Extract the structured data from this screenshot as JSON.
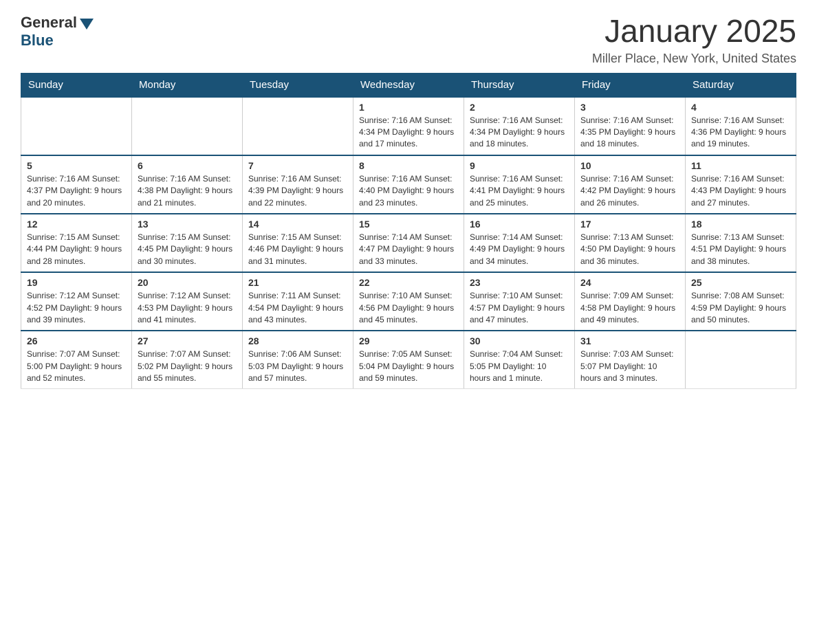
{
  "header": {
    "logo_general": "General",
    "logo_blue": "Blue",
    "month_title": "January 2025",
    "location": "Miller Place, New York, United States"
  },
  "weekdays": [
    "Sunday",
    "Monday",
    "Tuesday",
    "Wednesday",
    "Thursday",
    "Friday",
    "Saturday"
  ],
  "weeks": [
    [
      {
        "day": "",
        "info": ""
      },
      {
        "day": "",
        "info": ""
      },
      {
        "day": "",
        "info": ""
      },
      {
        "day": "1",
        "info": "Sunrise: 7:16 AM\nSunset: 4:34 PM\nDaylight: 9 hours\nand 17 minutes."
      },
      {
        "day": "2",
        "info": "Sunrise: 7:16 AM\nSunset: 4:34 PM\nDaylight: 9 hours\nand 18 minutes."
      },
      {
        "day": "3",
        "info": "Sunrise: 7:16 AM\nSunset: 4:35 PM\nDaylight: 9 hours\nand 18 minutes."
      },
      {
        "day": "4",
        "info": "Sunrise: 7:16 AM\nSunset: 4:36 PM\nDaylight: 9 hours\nand 19 minutes."
      }
    ],
    [
      {
        "day": "5",
        "info": "Sunrise: 7:16 AM\nSunset: 4:37 PM\nDaylight: 9 hours\nand 20 minutes."
      },
      {
        "day": "6",
        "info": "Sunrise: 7:16 AM\nSunset: 4:38 PM\nDaylight: 9 hours\nand 21 minutes."
      },
      {
        "day": "7",
        "info": "Sunrise: 7:16 AM\nSunset: 4:39 PM\nDaylight: 9 hours\nand 22 minutes."
      },
      {
        "day": "8",
        "info": "Sunrise: 7:16 AM\nSunset: 4:40 PM\nDaylight: 9 hours\nand 23 minutes."
      },
      {
        "day": "9",
        "info": "Sunrise: 7:16 AM\nSunset: 4:41 PM\nDaylight: 9 hours\nand 25 minutes."
      },
      {
        "day": "10",
        "info": "Sunrise: 7:16 AM\nSunset: 4:42 PM\nDaylight: 9 hours\nand 26 minutes."
      },
      {
        "day": "11",
        "info": "Sunrise: 7:16 AM\nSunset: 4:43 PM\nDaylight: 9 hours\nand 27 minutes."
      }
    ],
    [
      {
        "day": "12",
        "info": "Sunrise: 7:15 AM\nSunset: 4:44 PM\nDaylight: 9 hours\nand 28 minutes."
      },
      {
        "day": "13",
        "info": "Sunrise: 7:15 AM\nSunset: 4:45 PM\nDaylight: 9 hours\nand 30 minutes."
      },
      {
        "day": "14",
        "info": "Sunrise: 7:15 AM\nSunset: 4:46 PM\nDaylight: 9 hours\nand 31 minutes."
      },
      {
        "day": "15",
        "info": "Sunrise: 7:14 AM\nSunset: 4:47 PM\nDaylight: 9 hours\nand 33 minutes."
      },
      {
        "day": "16",
        "info": "Sunrise: 7:14 AM\nSunset: 4:49 PM\nDaylight: 9 hours\nand 34 minutes."
      },
      {
        "day": "17",
        "info": "Sunrise: 7:13 AM\nSunset: 4:50 PM\nDaylight: 9 hours\nand 36 minutes."
      },
      {
        "day": "18",
        "info": "Sunrise: 7:13 AM\nSunset: 4:51 PM\nDaylight: 9 hours\nand 38 minutes."
      }
    ],
    [
      {
        "day": "19",
        "info": "Sunrise: 7:12 AM\nSunset: 4:52 PM\nDaylight: 9 hours\nand 39 minutes."
      },
      {
        "day": "20",
        "info": "Sunrise: 7:12 AM\nSunset: 4:53 PM\nDaylight: 9 hours\nand 41 minutes."
      },
      {
        "day": "21",
        "info": "Sunrise: 7:11 AM\nSunset: 4:54 PM\nDaylight: 9 hours\nand 43 minutes."
      },
      {
        "day": "22",
        "info": "Sunrise: 7:10 AM\nSunset: 4:56 PM\nDaylight: 9 hours\nand 45 minutes."
      },
      {
        "day": "23",
        "info": "Sunrise: 7:10 AM\nSunset: 4:57 PM\nDaylight: 9 hours\nand 47 minutes."
      },
      {
        "day": "24",
        "info": "Sunrise: 7:09 AM\nSunset: 4:58 PM\nDaylight: 9 hours\nand 49 minutes."
      },
      {
        "day": "25",
        "info": "Sunrise: 7:08 AM\nSunset: 4:59 PM\nDaylight: 9 hours\nand 50 minutes."
      }
    ],
    [
      {
        "day": "26",
        "info": "Sunrise: 7:07 AM\nSunset: 5:00 PM\nDaylight: 9 hours\nand 52 minutes."
      },
      {
        "day": "27",
        "info": "Sunrise: 7:07 AM\nSunset: 5:02 PM\nDaylight: 9 hours\nand 55 minutes."
      },
      {
        "day": "28",
        "info": "Sunrise: 7:06 AM\nSunset: 5:03 PM\nDaylight: 9 hours\nand 57 minutes."
      },
      {
        "day": "29",
        "info": "Sunrise: 7:05 AM\nSunset: 5:04 PM\nDaylight: 9 hours\nand 59 minutes."
      },
      {
        "day": "30",
        "info": "Sunrise: 7:04 AM\nSunset: 5:05 PM\nDaylight: 10 hours\nand 1 minute."
      },
      {
        "day": "31",
        "info": "Sunrise: 7:03 AM\nSunset: 5:07 PM\nDaylight: 10 hours\nand 3 minutes."
      },
      {
        "day": "",
        "info": ""
      }
    ]
  ]
}
